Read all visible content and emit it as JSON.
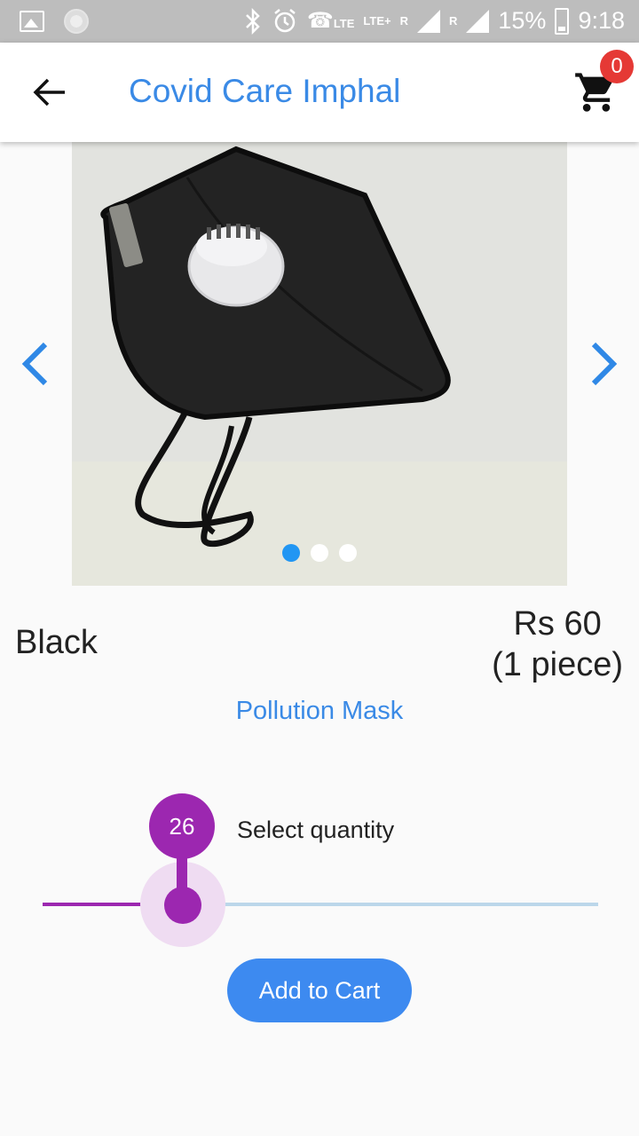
{
  "status_bar": {
    "battery": "15%",
    "time": "9:18",
    "lte1": "LTE",
    "lte2": "LTE+",
    "r1": "R",
    "r2": "R"
  },
  "appbar": {
    "title": "Covid Care Imphal",
    "cart_count": "0",
    "back_icon": "arrow-back-icon",
    "cart_icon": "shopping-cart-icon"
  },
  "carousel": {
    "image_subject": "black mask with white valve",
    "slide_count": 3,
    "active_slide": 1
  },
  "product": {
    "color": "Black",
    "price": "Rs 60",
    "unit": "(1 piece)",
    "name": "Pollution Mask"
  },
  "quantity": {
    "label": "Select quantity",
    "value": "26",
    "fraction": 0.25
  },
  "actions": {
    "add_to_cart": "Add to Cart"
  },
  "colors": {
    "accent": "#3a8ae6",
    "slider": "#9c27b0",
    "button": "#3d8af0",
    "badge": "#e53935"
  }
}
